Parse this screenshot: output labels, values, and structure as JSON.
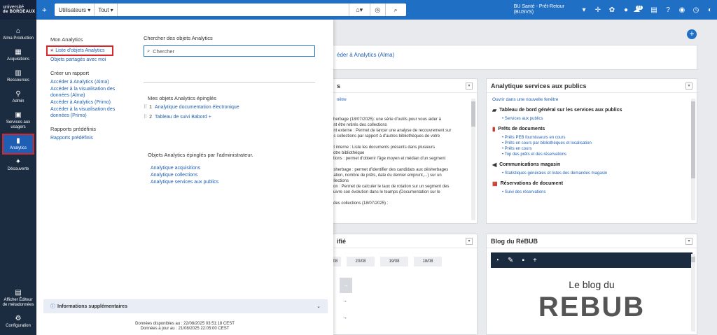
{
  "sidebar": {
    "logo_line1": "université",
    "logo_line2": "de BORDEAUX",
    "items": [
      {
        "label": "Alma Production",
        "icon": "home-icon"
      },
      {
        "label": "Acquisitions",
        "icon": "cart-icon"
      },
      {
        "label": "Ressources",
        "icon": "books-icon"
      },
      {
        "label": "Admin",
        "icon": "admin-icon"
      },
      {
        "label": "Services aux usagers",
        "icon": "inbox-icon"
      },
      {
        "label": "Analytics",
        "icon": "chart-icon"
      },
      {
        "label": "Découverte",
        "icon": "discovery-icon"
      }
    ],
    "bottom": [
      {
        "label": "Afficher Éditeur de métadonnées",
        "icon": "metadata-icon"
      },
      {
        "label": "Configuration",
        "icon": "gear-icon"
      }
    ]
  },
  "topbar": {
    "scope": "Utilisateurs",
    "filter": "Tout",
    "search_value": "",
    "institution_line1": "BU Santé - Prêt-Retour",
    "institution_line2": "(BUSVS)",
    "notification_count": "51"
  },
  "analytics_menu": {
    "my_analytics_heading": "Mon Analytics",
    "list_objects": "Liste d'objets Analytics",
    "shared_objects": "Objets partagés avec moi",
    "create_report_heading": "Créer un rapport",
    "create_links": [
      "Accéder à Analytics (Alma)",
      "Accéder à la visualisation des données (Alma)",
      "Accéder à Analytics (Primo)",
      "Accéder à la visualisation des données (Primo)"
    ],
    "predefined_heading": "Rapports prédéfinis",
    "predefined_link": "Rapports prédéfinis",
    "search_heading": "Chercher des objets Analytics",
    "search_placeholder": "Chercher",
    "pinned_heading": "Mes objets Analytics épinglés",
    "pinned": [
      {
        "num": "1",
        "label": "Analytique documentation électronique"
      },
      {
        "num": "2",
        "label": "Tableau de suivi Babord +"
      }
    ],
    "admin_pinned_heading": "Objets Analytics épinglés par l'administrateur.",
    "admin_pinned": [
      "Analytique acquisitions",
      "Analytique collections",
      "Analytique services aux publics"
    ],
    "info_label": "Informations supplémentaires",
    "data_available": "Données disponibles au : 22/08/2025 03:51:18 CEST",
    "data_updated": "Données à jour au : 21/08/2025 22:05:00 CEST"
  },
  "dashboard": {
    "access_partial": "éder à Analytics (Alma)",
    "widget1_title_partial": "s",
    "widget1_link_partial": "nêtre",
    "widget1_lines": [
      "sherbage (18/07/2025): une série d'outils pour vous aider à",
      "ant être retirés des collections",
      "ent externe : Permet de lancer une analyse de recouvrement sur",
      "os collections par rapport à d'autres bibliothèques de votre",
      "",
      "nt interne : Liste les documents présents dans plusieurs",
      "votre bibliothèque",
      "ctions : permet d'obtenir l'âge moyen et médian d'un segment",
      "",
      "ésherbage : permet d'identifier des candidats aux désherbages",
      "nation, nombre de prêts, date du dernier emprunt,...) sur un",
      "ollections",
      "tion : Permet de calculer le taux de rotation sur un segment des",
      "suivre son évolution dans le teamps (Documentation sur le",
      "",
      "i des collections (18/07/2025) :"
    ],
    "widget2_title_partial": "ifié",
    "dates": [
      "08",
      "20/08",
      "19/08",
      "18/08"
    ],
    "services_title": "Analytique services aux publics",
    "services_link": "Ouvrir dans une nouvelle fenêtre",
    "services_sections": [
      {
        "title": "Tableau de bord général sur les services aux publics",
        "icon": "dashboard-icon",
        "items": [
          "Services aux publics"
        ]
      },
      {
        "title": "Prêts de documents",
        "icon": "book-icon",
        "items": [
          "Prêts PEB fournisseurs en cours",
          "Prêts en cours par bibliothèques et localisation",
          "Prêts en cours",
          "Top des prêts et des réservations"
        ]
      },
      {
        "title": "Communications magasin",
        "icon": "megaphone-icon",
        "items": [
          "Statistiques générales et listes des demandes magasin"
        ]
      },
      {
        "title": "Réservations de document",
        "icon": "calendar-icon",
        "items": [
          "Suivi des réservations"
        ]
      }
    ],
    "blog_title": "Blog du RéBUB",
    "blog_subtitle": "Le blog du",
    "blog_logo": "REBUB",
    "colors": {
      "primary": "#1f6fc5",
      "sidebar": "#1b2b40",
      "highlight": "#d9262c"
    }
  }
}
